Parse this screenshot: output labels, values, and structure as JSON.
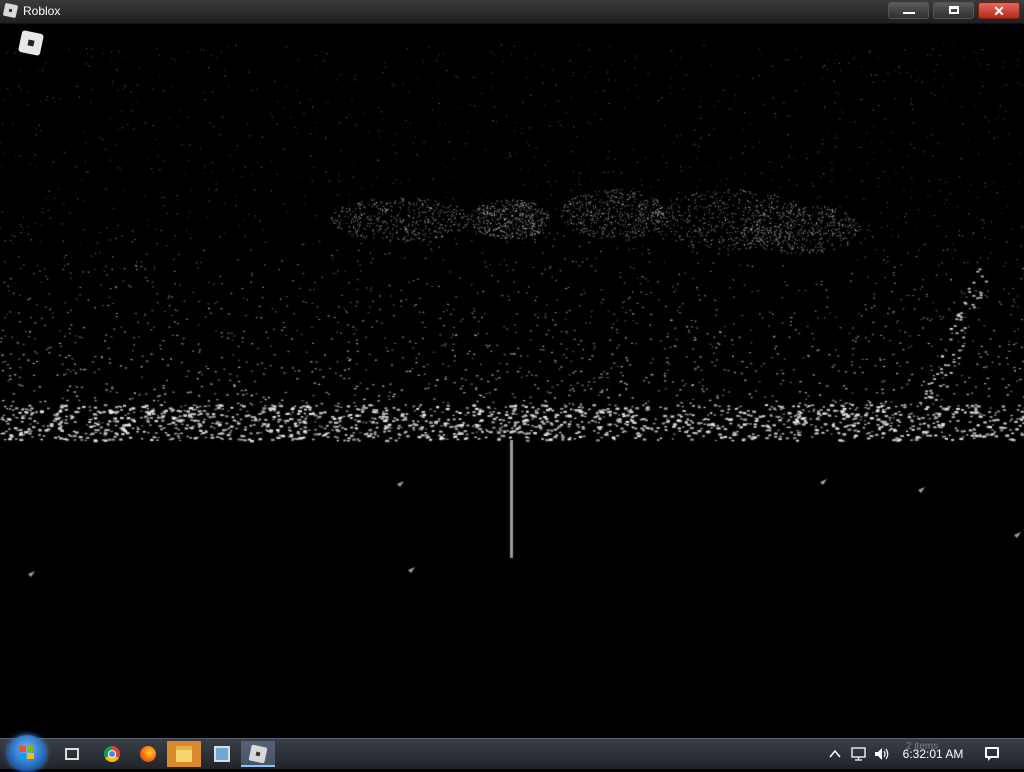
{
  "window": {
    "title": "Roblox",
    "app_icon": "roblox-icon",
    "controls": {
      "minimize": "minimize-icon",
      "maximize": "maximize-icon",
      "close": "close-icon"
    }
  },
  "game": {
    "menu_icon": "roblox-logo-icon",
    "scene": "dark point-cloud terrain with sparse white particles"
  },
  "taskbar": {
    "start_icon": "windows-start-icon",
    "apps": [
      {
        "icon": "task-view-icon",
        "active": false
      },
      {
        "icon": "chrome-icon",
        "active": false
      },
      {
        "icon": "firefox-icon",
        "active": false
      },
      {
        "icon": "file-explorer-icon",
        "active": true
      },
      {
        "icon": "photos-icon",
        "active": false
      },
      {
        "icon": "roblox-icon",
        "active": true
      }
    ],
    "tray": {
      "chevron_icon": "show-hidden-icons-chevron",
      "network_icon": "network-icon",
      "volume_icon": "volume-icon",
      "clock": "6:32:01 AM",
      "ghost_text": "2 items",
      "notification_icon": "action-center-icon"
    },
    "colors": {
      "accent": "#8fc3ff",
      "active_app": "#d98a2b",
      "close_button": "#c42b1c"
    }
  }
}
